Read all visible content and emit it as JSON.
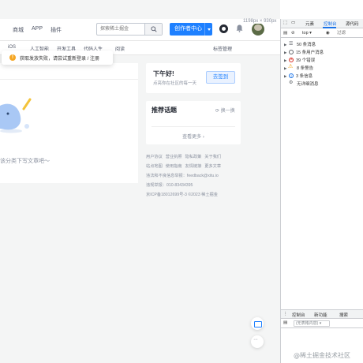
{
  "topnav": {
    "items": [
      "商城",
      "APP",
      "插件"
    ],
    "search_placeholder": "探索稀土掘金",
    "creator_label": "创作者中心",
    "size_readout": "1198px × 930px"
  },
  "subnav": {
    "items": [
      "iOS",
      "人工智能",
      "开发工具",
      "代码人生",
      "阅读"
    ],
    "tag_manage": "标签管理"
  },
  "toast": {
    "text": "获取发放失败，请尝试重新登录 / 注册"
  },
  "main": {
    "empty_text": "该分类下写文章吧～"
  },
  "greeting": {
    "title": "下午好!",
    "subtitle": "点亮你在社区的每一天",
    "checkin_label": "去签到"
  },
  "topics": {
    "title": "推荐话题",
    "refresh_label": "换一换",
    "more_label": "查看更多"
  },
  "footer": {
    "line1": [
      "用户协议",
      "营业执照",
      "隐私政策",
      "关于我们"
    ],
    "line2": [
      "站点地图",
      "使用指南",
      "友情链接",
      "更多文章"
    ],
    "line3": "违法和不良信息举报：feedback@xitu.io",
    "line4": "违规举报：010-83434395",
    "line5": "京ICP备18012699号-3  ©2023 稀土掘金"
  },
  "devtools": {
    "tabs": [
      "元素",
      "控制台",
      "源代码"
    ],
    "context": "top",
    "filter_placeholder": "过滤",
    "rows": [
      {
        "label": "50 条消息",
        "icon": "list"
      },
      {
        "label": "15 条用户消息",
        "icon": "user"
      },
      {
        "label": "39 个错误",
        "icon": "error"
      },
      {
        "label": "8 条警告",
        "icon": "warning"
      },
      {
        "label": "3 条信息",
        "icon": "info"
      },
      {
        "label": "无详细消息",
        "icon": "verbose"
      }
    ],
    "bottom_tabs": [
      "控制台",
      "新功能",
      "搜索"
    ],
    "bottom_context": "(无表格内容)"
  },
  "watermark": "@稀土掘金技术社区",
  "colors": {
    "brand": "#1e80ff",
    "devtools_accent": "#1a73e8",
    "error": "#d93025",
    "warning": "#f29900"
  }
}
